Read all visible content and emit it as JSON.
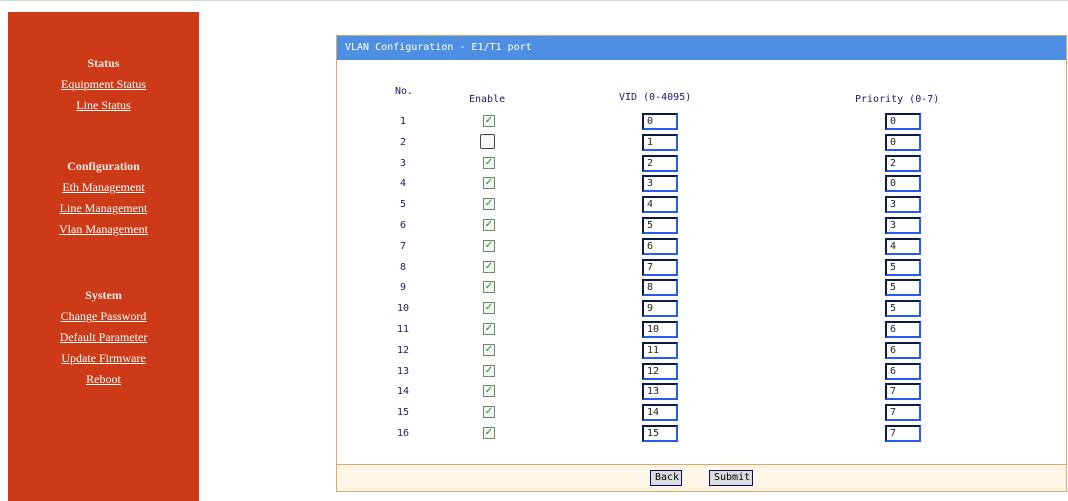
{
  "sidebar": {
    "status": {
      "heading": "Status",
      "links": [
        "Equipment Status",
        "Line Status"
      ]
    },
    "configuration": {
      "heading": "Configuration",
      "links": [
        "Eth Management",
        "Line Management",
        "Vlan Management"
      ]
    },
    "system": {
      "heading": "System",
      "links": [
        "Change Password",
        "Default Parameter",
        "Update Firmware",
        "Reboot"
      ]
    }
  },
  "panel": {
    "title": "VLAN Configuration - E1/T1 port",
    "columns": {
      "no": "No.",
      "enable": "Enable",
      "vid": "VID (0-4095)",
      "priority": "Priority (0-7)"
    },
    "rows": [
      {
        "no": "1",
        "enabled": true,
        "vid": "0",
        "priority": "0"
      },
      {
        "no": "2",
        "enabled": false,
        "vid": "1",
        "priority": "0"
      },
      {
        "no": "3",
        "enabled": true,
        "vid": "2",
        "priority": "2"
      },
      {
        "no": "4",
        "enabled": true,
        "vid": "3",
        "priority": "0"
      },
      {
        "no": "5",
        "enabled": true,
        "vid": "4",
        "priority": "3"
      },
      {
        "no": "6",
        "enabled": true,
        "vid": "5",
        "priority": "3"
      },
      {
        "no": "7",
        "enabled": true,
        "vid": "6",
        "priority": "4"
      },
      {
        "no": "8",
        "enabled": true,
        "vid": "7",
        "priority": "5"
      },
      {
        "no": "9",
        "enabled": true,
        "vid": "8",
        "priority": "5"
      },
      {
        "no": "10",
        "enabled": true,
        "vid": "9",
        "priority": "5"
      },
      {
        "no": "11",
        "enabled": true,
        "vid": "10",
        "priority": "6"
      },
      {
        "no": "12",
        "enabled": true,
        "vid": "11",
        "priority": "6"
      },
      {
        "no": "13",
        "enabled": true,
        "vid": "12",
        "priority": "6"
      },
      {
        "no": "14",
        "enabled": true,
        "vid": "13",
        "priority": "7"
      },
      {
        "no": "15",
        "enabled": true,
        "vid": "14",
        "priority": "7"
      },
      {
        "no": "16",
        "enabled": true,
        "vid": "15",
        "priority": "7"
      }
    ],
    "buttons": {
      "back": "Back",
      "submit": "Submit"
    }
  },
  "colors": {
    "sidebar_bg": "#cc3a17",
    "header_bg": "#4f8fe3",
    "footer_bg": "#fdf6e7"
  }
}
